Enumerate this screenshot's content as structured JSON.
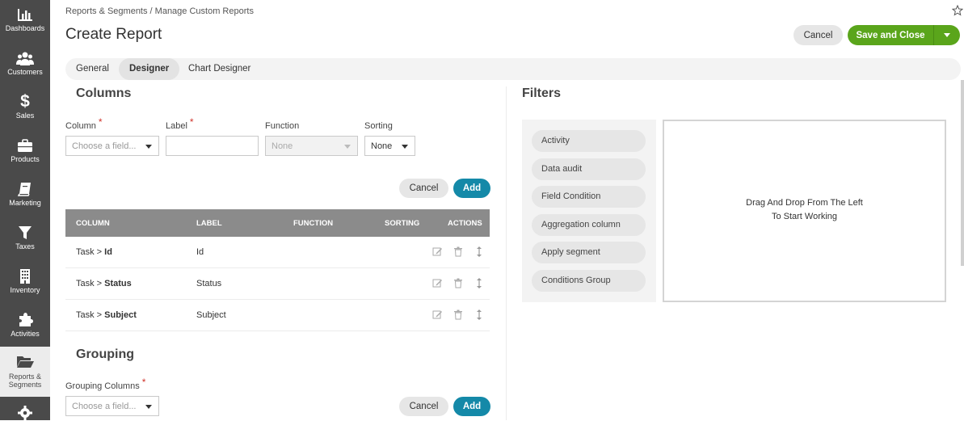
{
  "sidebar": {
    "items": [
      {
        "label": "Dashboards",
        "icon": "bar-chart-icon"
      },
      {
        "label": "Customers",
        "icon": "users-icon"
      },
      {
        "label": "Sales",
        "icon": "dollar-icon"
      },
      {
        "label": "Products",
        "icon": "briefcase-icon"
      },
      {
        "label": "Marketing",
        "icon": "book-icon"
      },
      {
        "label": "Taxes",
        "icon": "filter-icon"
      },
      {
        "label": "Inventory",
        "icon": "building-icon"
      },
      {
        "label": "Activities",
        "icon": "puzzle-icon"
      },
      {
        "label": "Reports &",
        "label2": "Segments",
        "icon": "folder-open-icon"
      },
      {
        "icon": "gear-icon"
      }
    ]
  },
  "header": {
    "breadcrumb": "Reports & Segments / Manage Custom Reports",
    "title": "Create Report",
    "cancel_label": "Cancel",
    "save_label": "Save and Close"
  },
  "tabs": [
    {
      "label": "General"
    },
    {
      "label": "Designer"
    },
    {
      "label": "Chart Designer"
    }
  ],
  "columns": {
    "title": "Columns",
    "column_label": "Column",
    "column_placeholder": "Choose a field...",
    "label_label": "Label",
    "function_label": "Function",
    "function_value": "None",
    "sorting_label": "Sorting",
    "sorting_value": "None",
    "cancel_label": "Cancel",
    "add_label": "Add"
  },
  "table": {
    "headers": [
      "COLUMN",
      "LABEL",
      "FUNCTION",
      "SORTING",
      "ACTIONS"
    ],
    "rows": [
      {
        "prefix": "Task > ",
        "field": "Id",
        "label": "Id"
      },
      {
        "prefix": "Task > ",
        "field": "Status",
        "label": "Status"
      },
      {
        "prefix": "Task > ",
        "field": "Subject",
        "label": "Subject"
      }
    ]
  },
  "grouping": {
    "title": "Grouping",
    "columns_label": "Grouping Columns",
    "placeholder": "Choose a field...",
    "cancel_label": "Cancel",
    "add_label": "Add"
  },
  "filters": {
    "title": "Filters",
    "items": [
      "Activity",
      "Data audit",
      "Field Condition",
      "Aggregation column",
      "Apply segment",
      "Conditions Group"
    ],
    "drop_line1": "Drag And Drop From The Left",
    "drop_line2": "To Start Working"
  },
  "colors": {
    "sidebar_bg": "#4a4a4a",
    "save_green": "#5aa51b",
    "add_blue": "#1489a8",
    "table_header": "#8b8b8b",
    "required_red": "#d0332b"
  }
}
